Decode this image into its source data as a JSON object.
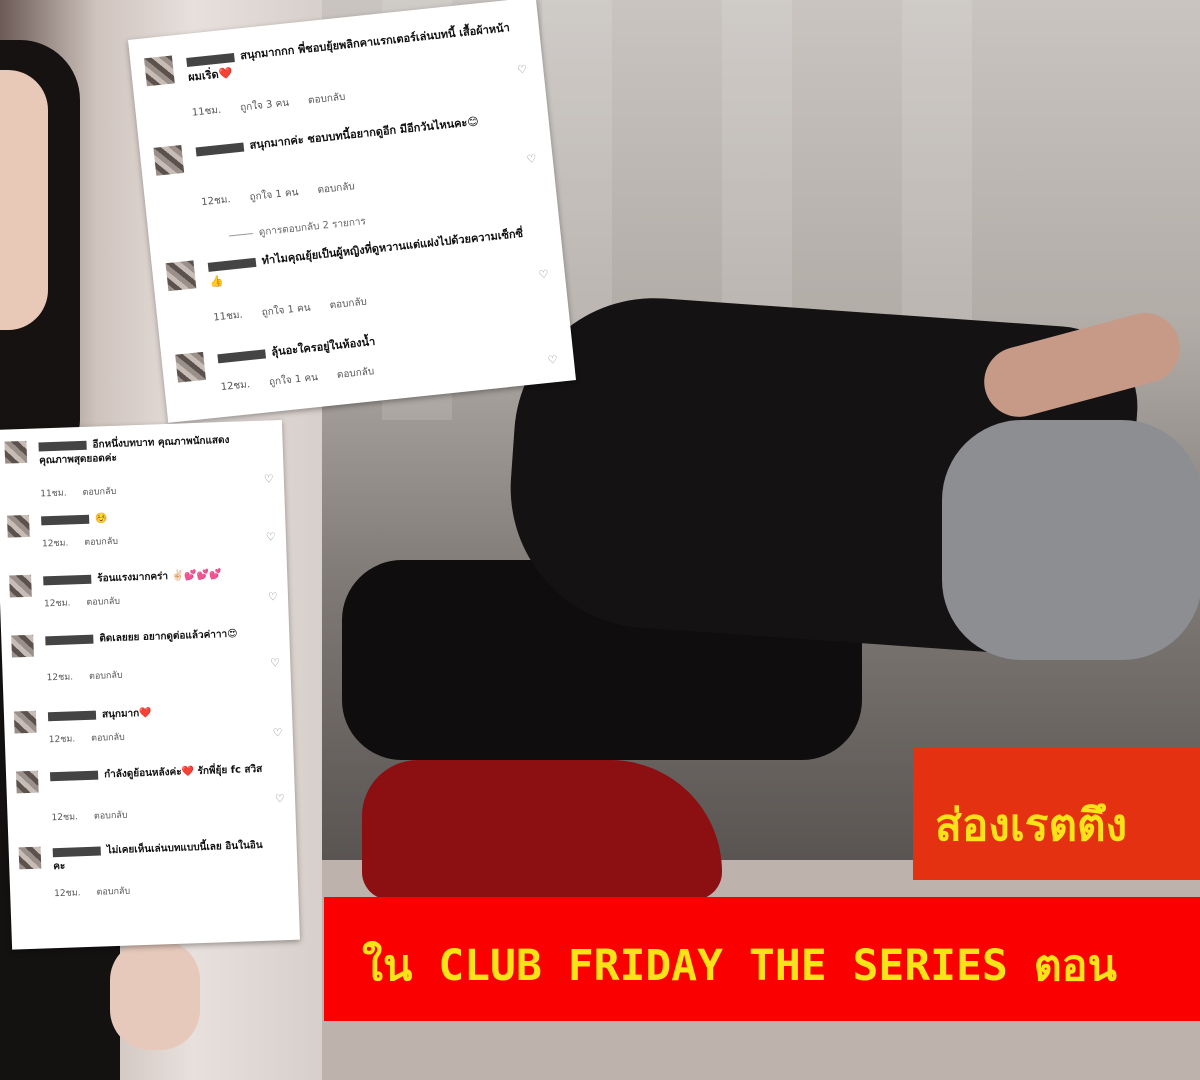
{
  "top_card": {
    "comments": [
      {
        "text": "สนุกมากกก พี่ชอบยุ้ยพลิกคาแรกเตอร์เล่นบทนี้ เสื้อผ้าหน้าผมเริ่ด❤️",
        "time": "11ชม.",
        "likes": "ถูกใจ 3 คน",
        "reply": "ตอบกลับ"
      },
      {
        "text": "สนุกมากค่ะ ชอบบทนี้อยากดูอีก มีอีกวันไหนคะ😊",
        "time": "12ชม.",
        "likes": "ถูกใจ 1 คน",
        "reply": "ตอบกลับ"
      },
      {
        "text": "ทำไมคุณยุ้ยเป็นผู้หญิงที่ดูหวานแต่แฝงไปด้วยความเซ็กซี่👍",
        "time": "11ชม.",
        "likes": "ถูกใจ 1 คน",
        "reply": "ตอบกลับ"
      },
      {
        "text": "ลุ้นอะใครอยู่ในห้องน้ำ",
        "time": "12ชม.",
        "likes": "ถูกใจ 1 คน",
        "reply": "ตอบกลับ"
      }
    ],
    "view_replies": "ดูการตอบกลับ 2 รายการ"
  },
  "left_card": {
    "comments": [
      {
        "text": "อีกหนึ่งบทบาท คุณภาพนักแสดงคุณภาพสุดยอดค่ะ",
        "time": "11ชม.",
        "reply": "ตอบกลับ"
      },
      {
        "text": "☺️",
        "time": "12ชม.",
        "reply": "ตอบกลับ"
      },
      {
        "text": "ร้อนแรงมากคร่า ✌🏻💕💕💕",
        "time": "12ชม.",
        "reply": "ตอบกลับ"
      },
      {
        "text": "ติดเลยยย อยากดูต่อแล้วค่าาา😍",
        "time": "12ชม.",
        "reply": "ตอบกลับ"
      },
      {
        "text": "สนุกมาก❤️",
        "time": "12ชม.",
        "reply": "ตอบกลับ"
      },
      {
        "text": "กำลังดูย้อนหลังค่ะ❤️ รักพี่ยุ้ย fc สวิส",
        "time": "12ชม.",
        "reply": "ตอบกลับ"
      },
      {
        "text": "ไม่เคยเห็นเล่นบทแบบนี้เลย อินในอินคะ",
        "time": "12ชม.",
        "reply": "ตอบกลับ"
      }
    ]
  },
  "banner_top": "ส่องเรตตึง",
  "banner_bottom": "ใน CLUB FRIDAY THE SERIES ตอน",
  "colors": {
    "banner_orange": "#e43111",
    "banner_red": "#fb0000",
    "banner_text": "#f7e318"
  }
}
